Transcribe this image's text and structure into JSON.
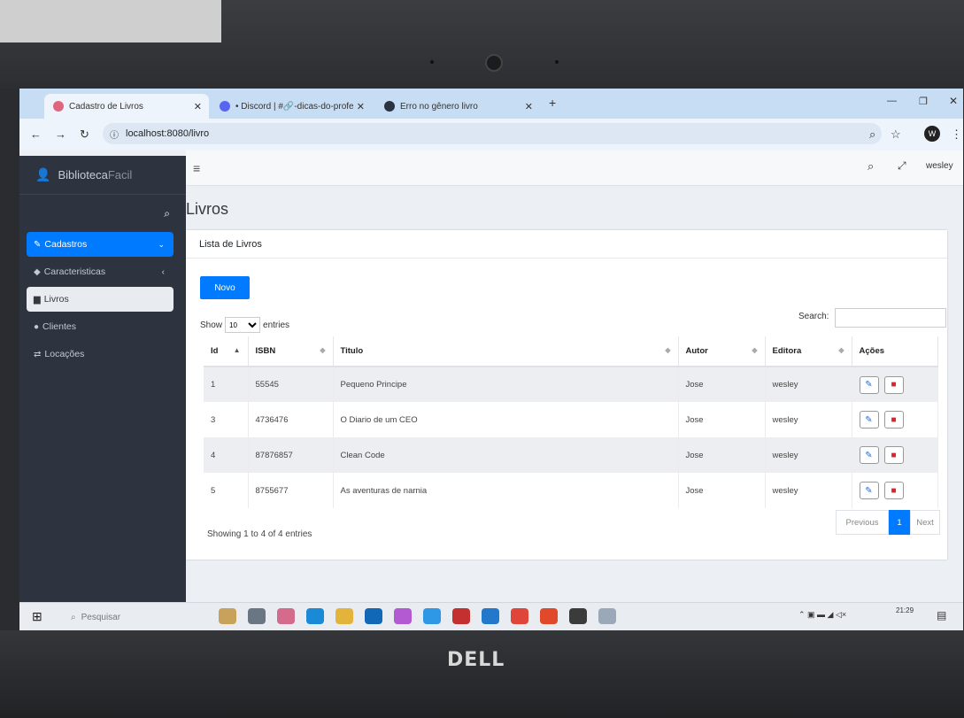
{
  "browser": {
    "tabs": [
      {
        "label": "Cadastro de Livros",
        "active": true
      },
      {
        "label": "• Discord | #🔗-dicas-do-profe",
        "active": false
      },
      {
        "label": "Erro no gênero livro",
        "active": false
      }
    ],
    "url": "localhost:8080/livro",
    "profile_initial": "W"
  },
  "sidebar": {
    "brand_part1": "Biblioteca",
    "brand_part2": "Facil",
    "items": [
      {
        "label": "Cadastros"
      },
      {
        "label": "Caracteristicas"
      },
      {
        "label": "Livros"
      },
      {
        "label": "Clientes"
      },
      {
        "label": "Locações"
      }
    ]
  },
  "topnav": {
    "user": "wesley"
  },
  "page": {
    "title": "Livros",
    "card_title": "Lista de Livros",
    "new_button": "Novo",
    "show_label": "Show",
    "entries_label": "entries",
    "page_size": "10",
    "search_label": "Search:",
    "table": {
      "columns": [
        "Id",
        "ISBN",
        "Titulo",
        "Autor",
        "Editora",
        "Ações"
      ],
      "rows": [
        {
          "id": "1",
          "isbn": "55545",
          "titulo": "Pequeno Principe",
          "autor": "Jose",
          "editora": "wesley"
        },
        {
          "id": "3",
          "isbn": "4736476",
          "titulo": "O Diario de um CEO",
          "autor": "Jose",
          "editora": "wesley"
        },
        {
          "id": "4",
          "isbn": "87876857",
          "titulo": "Clean Code",
          "autor": "Jose",
          "editora": "wesley"
        },
        {
          "id": "5",
          "isbn": "8755677",
          "titulo": "As aventuras de narnia",
          "autor": "Jose",
          "editora": "wesley"
        }
      ]
    },
    "info": "Showing 1 to 4 of 4 entries",
    "pager": {
      "prev": "Previous",
      "current": "1",
      "next": "Next"
    }
  },
  "taskbar": {
    "search_placeholder": "Pesquisar",
    "time": "21:29"
  },
  "laptop": {
    "brand": "DELL"
  },
  "colors": {
    "primary": "#007bff",
    "sidebar": "#2d3440",
    "danger": "#d9232e"
  }
}
